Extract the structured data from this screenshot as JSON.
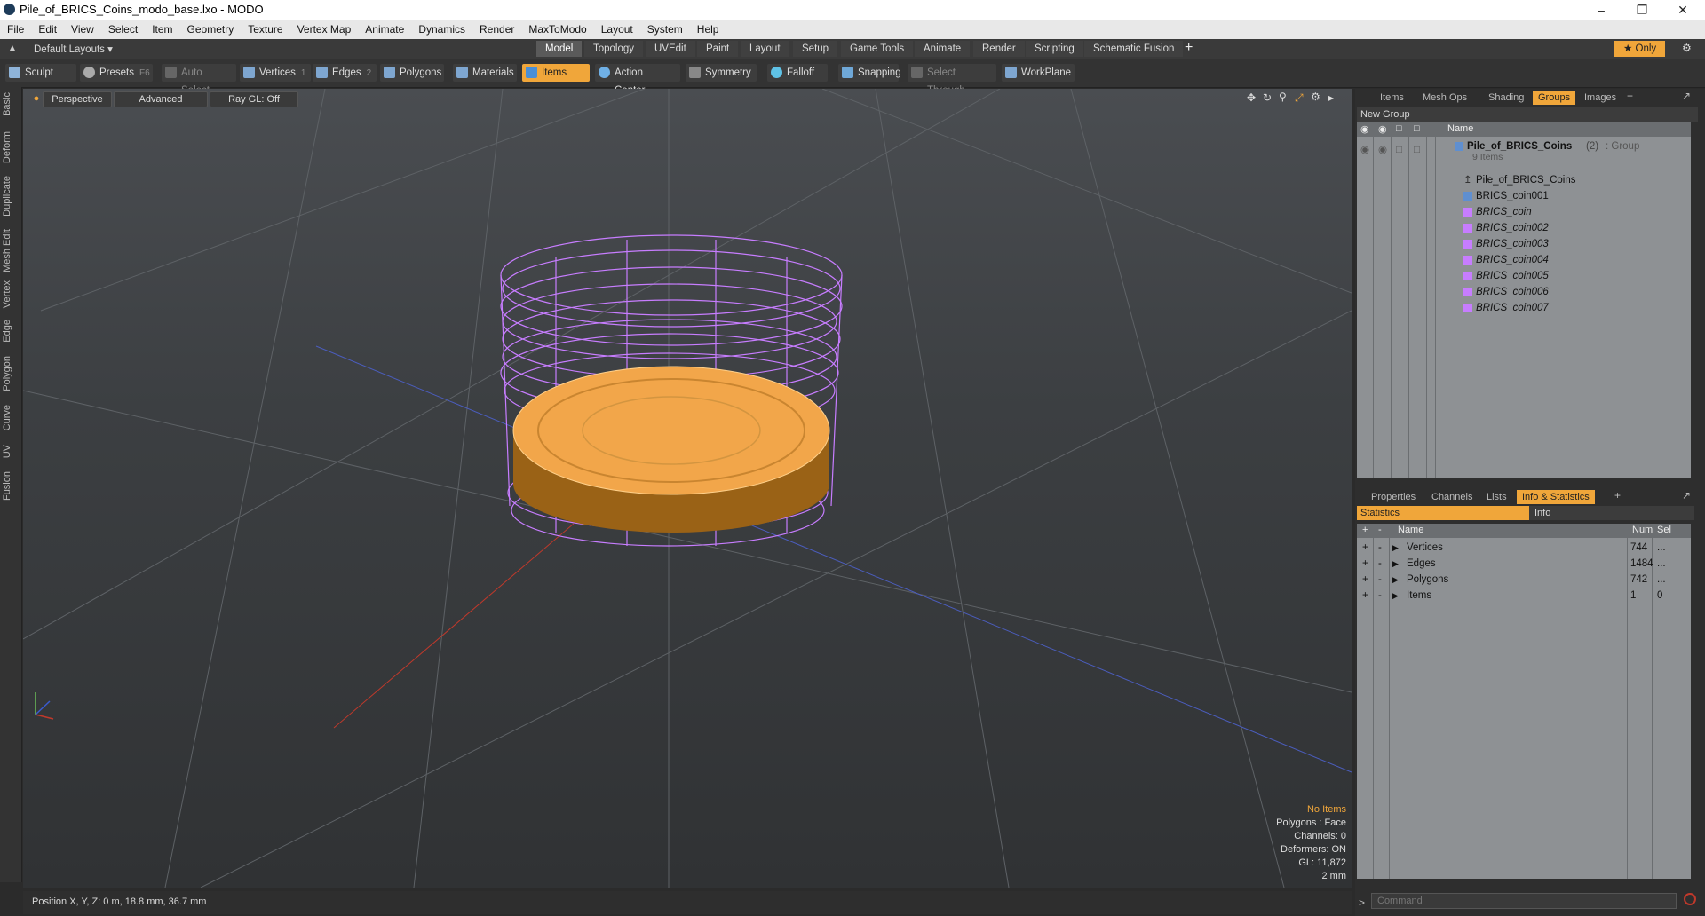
{
  "window": {
    "title": "Pile_of_BRICS_Coins_modo_base.lxo - MODO"
  },
  "menu": [
    "File",
    "Edit",
    "View",
    "Select",
    "Item",
    "Geometry",
    "Texture",
    "Vertex Map",
    "Animate",
    "Dynamics",
    "Render",
    "MaxToModo",
    "Layout",
    "System",
    "Help"
  ],
  "layout": {
    "preset": "Default Layouts",
    "tabs": [
      "Model",
      "Topology",
      "UVEdit",
      "Paint",
      "Layout",
      "Setup",
      "Game Tools",
      "Animate",
      "Render",
      "Scripting",
      "Schematic Fusion"
    ],
    "active_tab": "Model",
    "add": "+",
    "only": "Only"
  },
  "toolbar": {
    "sculpt": "Sculpt",
    "presets": "Presets",
    "presets_key": "F6",
    "auto_select": "Auto Select",
    "vertices": "Vertices",
    "vertices_count": "1",
    "edges": "Edges",
    "edges_count": "2",
    "polygons": "Polygons",
    "materials": "Materials",
    "items": "Items",
    "action_center": "Action Center",
    "symmetry": "Symmetry",
    "falloff": "Falloff",
    "snapping": "Snapping",
    "select_through": "Select Through",
    "workplane": "WorkPlane"
  },
  "left_tabs": [
    "Basic",
    "Deform",
    "Duplicate",
    "Mesh Edit",
    "Vertex",
    "Edge",
    "Polygon",
    "Curve",
    "UV",
    "Fusion"
  ],
  "viewport": {
    "perspective": "Perspective",
    "advanced": "Advanced",
    "raygl": "Ray GL: Off",
    "hud": {
      "no_items": "No Items",
      "polygons": "Polygons : Face",
      "channels": "Channels: 0",
      "deformers": "Deformers: ON",
      "gl": "GL: 11,872",
      "scale": "2 mm"
    }
  },
  "status": {
    "position": "Position X, Y, Z:  0 m, 18.8 mm, 36.7 mm"
  },
  "groups_panel": {
    "tabs": [
      "Items",
      "Mesh Ops",
      "Shading",
      "Groups",
      "Images"
    ],
    "active_tab": "Groups",
    "new_group": "New Group",
    "col_name": "Name",
    "group_name": "Pile_of_BRICS_Coins",
    "group_count": "(2)",
    "group_type": ": Group",
    "group_sub": "9 Items",
    "items": [
      "Pile_of_BRICS_Coins",
      "BRICS_coin001",
      "BRICS_coin",
      "BRICS_coin002",
      "BRICS_coin003",
      "BRICS_coin004",
      "BRICS_coin005",
      "BRICS_coin006",
      "BRICS_coin007"
    ]
  },
  "stats_panel": {
    "tabs": [
      "Properties",
      "Channels",
      "Lists",
      "Info & Statistics"
    ],
    "active_tab": "Info & Statistics",
    "sub_tabs": [
      "Statistics",
      "Info"
    ],
    "col_name": "Name",
    "col_num": "Num",
    "col_sel": "Sel",
    "rows": [
      {
        "name": "Vertices",
        "num": "744",
        "sel": "..."
      },
      {
        "name": "Edges",
        "num": "1484",
        "sel": "..."
      },
      {
        "name": "Polygons",
        "num": "742",
        "sel": "..."
      },
      {
        "name": "Items",
        "num": "1",
        "sel": "0"
      }
    ]
  },
  "command": {
    "placeholder": "Command"
  },
  "colors": {
    "accent": "#f0a63a",
    "wire": "#c77dff",
    "coin": "#f2a64a"
  }
}
